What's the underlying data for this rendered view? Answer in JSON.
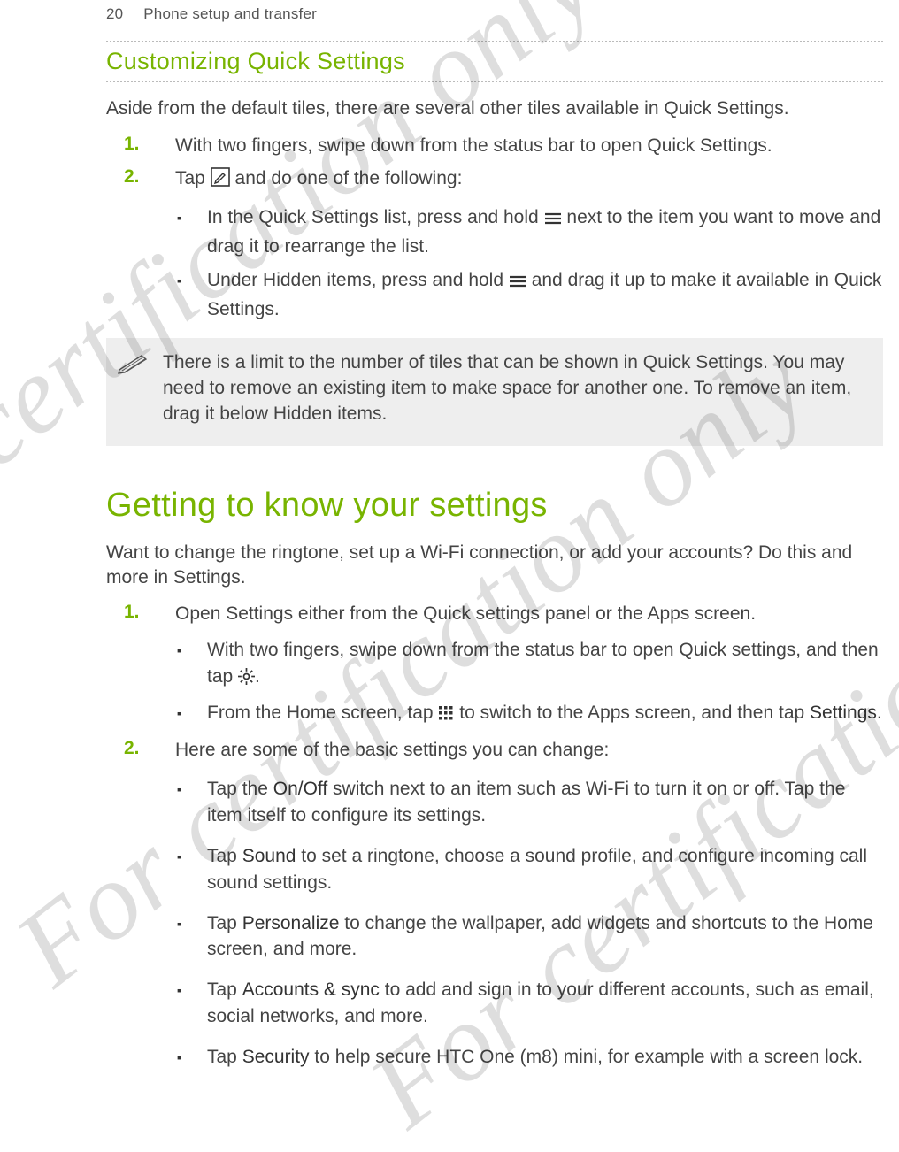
{
  "watermark": "For certification only",
  "header": {
    "page_num": "20",
    "section": "Phone setup and transfer"
  },
  "s1": {
    "title": "Customizing Quick Settings",
    "intro": "Aside from the default tiles, there are several other tiles available in Quick Settings.",
    "step1": "With two fingers, swipe down from the status bar to open Quick Settings.",
    "step2_a": "Tap ",
    "step2_b": " and do one of the following:",
    "b1_a": "In the Quick Settings list, press and hold ",
    "b1_b": " next to the item you want to move and drag it to rearrange the list.",
    "b2_a": "Under Hidden items, press and hold ",
    "b2_b": " and drag it up to make it available in Quick Settings.",
    "note": "There is a limit to the number of tiles that can be shown in Quick Settings. You may need to remove an existing item to make space for another one. To remove an item, drag it below Hidden items."
  },
  "s2": {
    "title": "Getting to know your settings",
    "intro": "Want to change the ringtone, set up a Wi-Fi connection, or add your accounts? Do this and more in Settings.",
    "step1": "Open Settings either from the Quick settings panel or the Apps screen.",
    "s1_b1_a": "With two fingers, swipe down from the status bar to open Quick settings, and then tap ",
    "s1_b1_b": ".",
    "s1_b2_a": "From the Home screen, tap ",
    "s1_b2_b": " to switch to the Apps screen, and then tap ",
    "s1_b2_bold": "Settings",
    "s1_b2_c": ".",
    "step2": "Here are some of the basic settings you can change:",
    "s2_b1_a": "Tap the ",
    "s2_b1_bold": "On/Off",
    "s2_b1_b": " switch next to an item such as Wi-Fi to turn it on or off. Tap the item itself to configure its settings.",
    "s2_b2_a": "Tap ",
    "s2_b2_bold": "Sound",
    "s2_b2_b": " to set a ringtone, choose a sound profile, and configure incoming call sound settings.",
    "s2_b3_a": "Tap ",
    "s2_b3_bold": "Personalize",
    "s2_b3_b": " to change the wallpaper, add widgets and shortcuts to the Home screen, and more.",
    "s2_b4_a": "Tap ",
    "s2_b4_bold": "Accounts & sync",
    "s2_b4_b": " to add and sign in to your different accounts, such as email, social networks, and more.",
    "s2_b5_a": "Tap ",
    "s2_b5_bold": "Security",
    "s2_b5_b": " to help secure HTC One (m8) mini, for example with a screen lock."
  }
}
